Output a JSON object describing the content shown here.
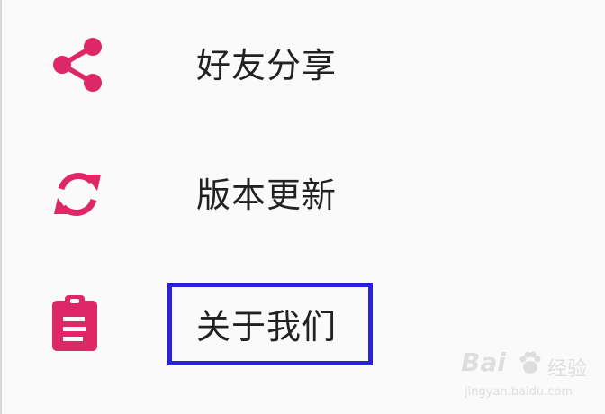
{
  "menu": {
    "items": [
      {
        "label": "好友分享",
        "icon": "share-icon"
      },
      {
        "label": "版本更新",
        "icon": "refresh-icon"
      },
      {
        "label": "关于我们",
        "icon": "clipboard-icon"
      }
    ]
  },
  "highlight": {
    "target": "关于我们",
    "color": "#2a22d8"
  },
  "colors": {
    "icon": "#dd2767",
    "text": "#222222",
    "background": "#fafafa"
  },
  "watermark": {
    "brand": "Bai",
    "brand_tail": "经验",
    "url": "jingyan.baidu.com"
  }
}
